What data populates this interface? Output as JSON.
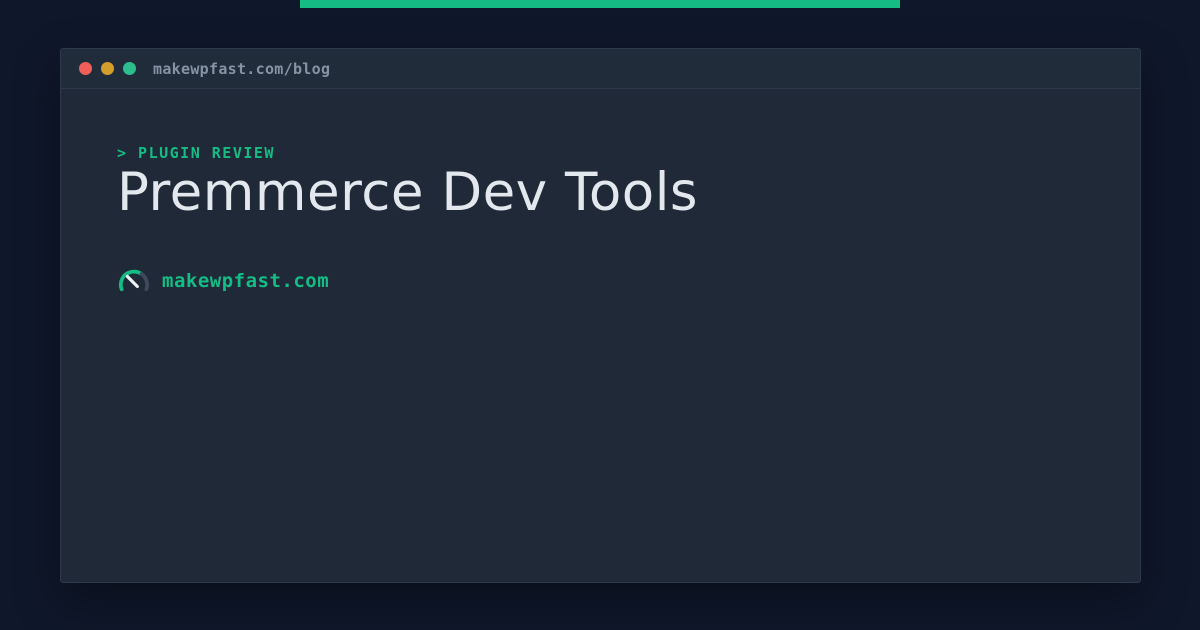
{
  "accent_bar": {
    "color": "#15bc84"
  },
  "browser_window": {
    "titlebar": {
      "url": "makewpfast.com/blog",
      "traffic_lights": [
        {
          "name": "close",
          "color": "#f15e5a"
        },
        {
          "name": "minimize",
          "color": "#d39e2c"
        },
        {
          "name": "maximize",
          "color": "#2dbe8d"
        }
      ]
    },
    "body": {
      "eyebrow": "> PLUGIN REVIEW",
      "title": "Premmerce Dev Tools",
      "site": {
        "icon": "speedometer-icon",
        "label": "makewpfast.com"
      }
    }
  },
  "colors": {
    "page_background": "#0f172a",
    "window_background": "#1f2937",
    "titlebar_background": "#212c3b",
    "window_border": "#2e3a4c",
    "accent_green": "#15bc84",
    "title_text": "#e3e8ee",
    "url_text": "#8593a4",
    "gauge_arc_muted": "#3e4a5c",
    "gauge_needle": "#eef2f6"
  }
}
